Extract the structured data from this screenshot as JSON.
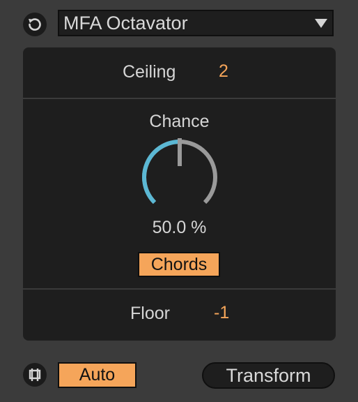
{
  "device": {
    "preset_name": "MFA Octavator",
    "ceiling": {
      "label": "Ceiling",
      "value": "2"
    },
    "chance": {
      "label": "Chance",
      "readout": "50.0 %",
      "level": 0.5
    },
    "chords_label": "Chords",
    "floor": {
      "label": "Floor",
      "value": "-1"
    },
    "auto_label": "Auto",
    "transform_label": "Transform"
  },
  "colors": {
    "accent": "#f5a55a",
    "knob_arc": "#5bb8d4",
    "knob_track": "#9a9a9a",
    "panel": "#1e1e1e",
    "background": "#3b3b3b"
  },
  "icons": {
    "preset": "reset-icon",
    "auto": "loop-bracket-icon",
    "dropdown": "triangle-down-icon"
  }
}
